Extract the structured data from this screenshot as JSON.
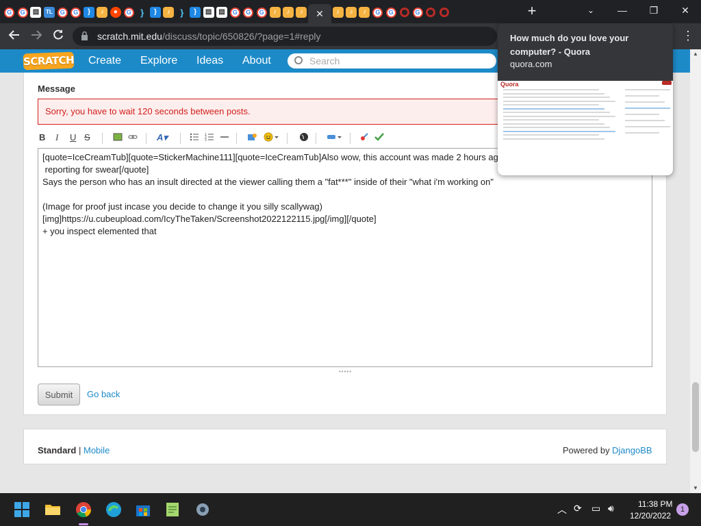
{
  "browser": {
    "tab_favicons": [
      "g",
      "g",
      "w",
      "t",
      "g",
      "g",
      "c",
      "s",
      "r",
      "g",
      "b",
      "c",
      "s",
      "b",
      "c",
      "w",
      "w",
      "g",
      "g",
      "g",
      "s",
      "s",
      "s",
      "active",
      "s",
      "s",
      "s",
      "g",
      "g",
      "q",
      "g",
      "q",
      "q"
    ],
    "url_host": "scratch.mit.edu",
    "url_path": "/discuss/topic/650826/?page=1#reply",
    "newtab_label": "+",
    "minimize_label": "—",
    "maximize_label": "❐",
    "close_label": "✕",
    "tabs_dropdown_label": "⌄"
  },
  "hover_card": {
    "title": "How much do you love your computer? - Quora",
    "domain": "quora.com",
    "preview_logo": "Quora"
  },
  "scratch_nav": {
    "logo": "SCRATCH",
    "create": "Create",
    "explore": "Explore",
    "ideas": "Ideas",
    "about": "About",
    "search_placeholder": "Search"
  },
  "form": {
    "message_label": "Message",
    "error": "Sorry, you have to wait 120 seconds between posts.",
    "editor_text": "[quote=IceCreamTub][quote=StickerMachine111][quote=IceCreamTub]Also wow, this account was made 2 hours ag\n reporting for swear[/quote]\nSays the person who has an insult directed at the viewer calling them a \"fat***\" inside of their \"what i'm working on\"\n\n(Image for proof just incase you decide to change it you silly scallywag)\n[img]https://u.cubeupload.com/IcyTheTaken/Screenshot2022122115.jpg[/img][/quote]\n+ you inspect elemented that",
    "submit": "Submit",
    "go_back": "Go back"
  },
  "editor_toolbar": {
    "bold": "B",
    "italic": "I",
    "underline": "U",
    "strike": "S"
  },
  "footer": {
    "standard": "Standard",
    "separator": "|",
    "mobile": "Mobile",
    "powered_by": "Powered by",
    "djangobb": "DjangoBB"
  },
  "taskbar": {
    "time": "11:38 PM",
    "date": "12/20/2022",
    "notification_count": "1"
  },
  "colors": {
    "scratch_blue": "#1d8ac8",
    "error_red": "#d0201a",
    "chrome_dark": "#202124"
  }
}
